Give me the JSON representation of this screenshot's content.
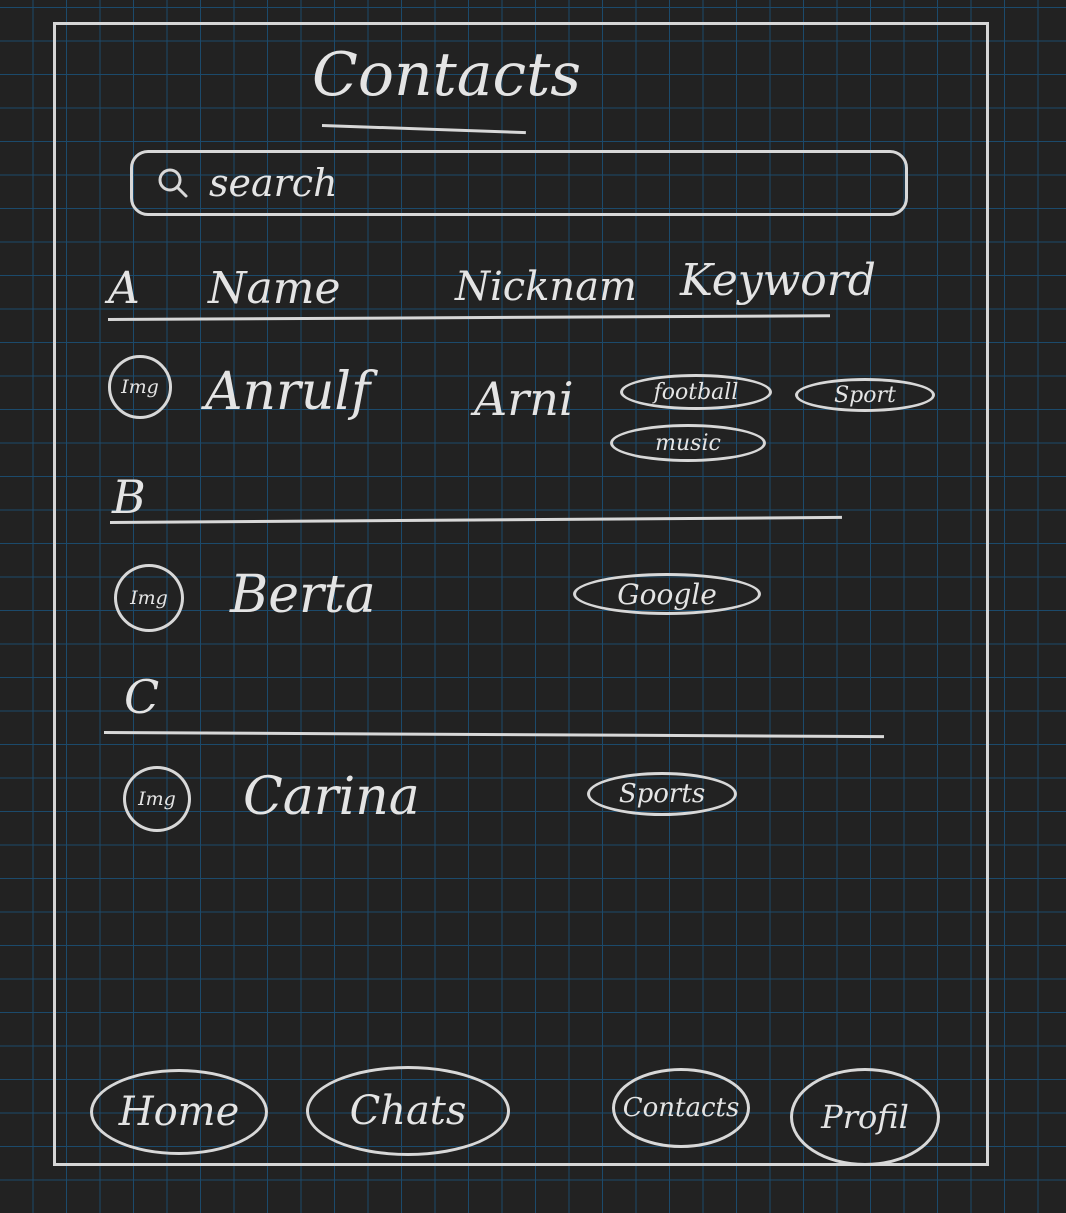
{
  "header": {
    "title": "Contacts"
  },
  "search": {
    "placeholder": "search"
  },
  "columns": {
    "index_letter": "A",
    "name": "Name",
    "nickname": "Nicknam",
    "keyword": "Keyword"
  },
  "sections": [
    {
      "letter": "A",
      "contacts": [
        {
          "avatar": "Img",
          "name": "Anrulf",
          "nickname": "Arni",
          "keywords": [
            "football",
            "Sport",
            "music"
          ]
        }
      ]
    },
    {
      "letter": "B",
      "contacts": [
        {
          "avatar": "Img",
          "name": "Berta",
          "nickname": "",
          "keywords": [
            "Google"
          ]
        }
      ]
    },
    {
      "letter": "C",
      "contacts": [
        {
          "avatar": "Img",
          "name": "Carina",
          "nickname": "",
          "keywords": [
            "Sports"
          ]
        }
      ]
    }
  ],
  "nav": {
    "home": "Home",
    "chats": "Chats",
    "contacts": "Contacts",
    "profile": "Profil"
  },
  "colors": {
    "background": "#222222",
    "grid": "#1c4a6b",
    "ink": "#d8d8d8"
  }
}
